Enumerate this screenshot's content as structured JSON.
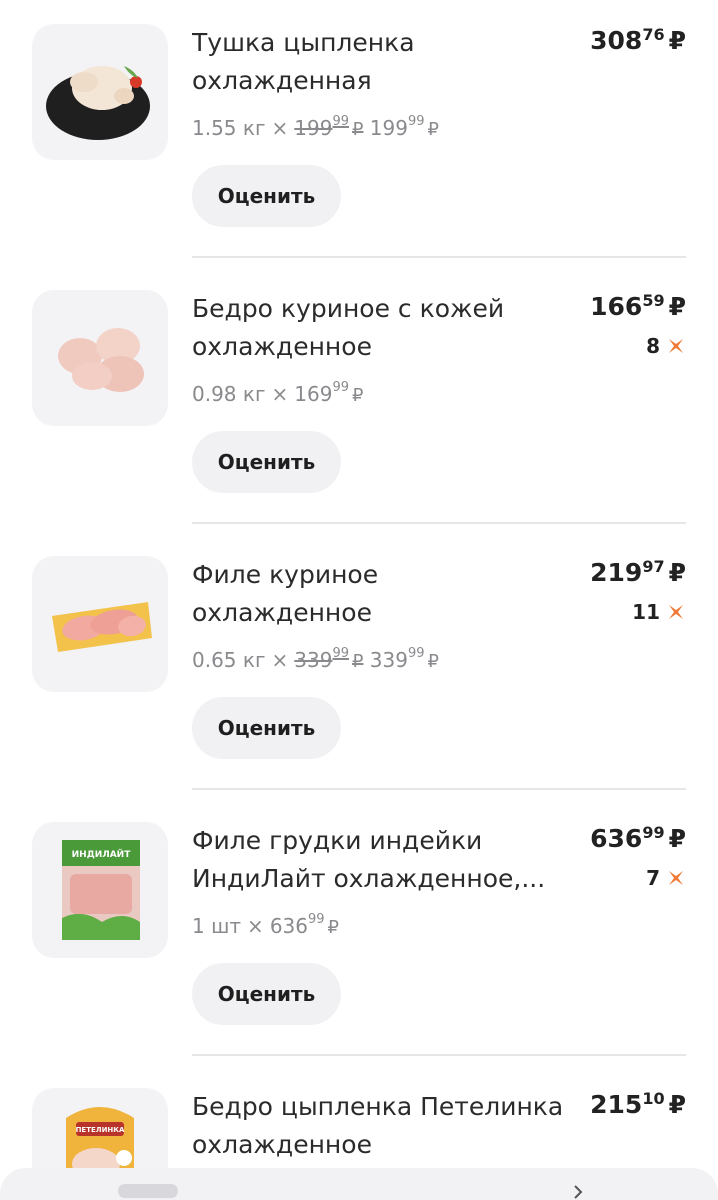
{
  "items": [
    {
      "title_lines": [
        "Тушка цыпленка",
        "охлажденная"
      ],
      "weight": "1.55 кг",
      "old_unit_price": {
        "int": "199",
        "dec": "99"
      },
      "unit_price": {
        "int": "199",
        "dec": "99"
      },
      "total": {
        "int": "308",
        "dec": "76"
      },
      "bonus": "",
      "rate_label": "Оценить",
      "image": "whole-chicken-image"
    },
    {
      "title_lines": [
        "Бедро куриное с кожей",
        "охлажденное"
      ],
      "weight": "0.98 кг",
      "old_unit_price": null,
      "unit_price": {
        "int": "169",
        "dec": "99"
      },
      "total": {
        "int": "166",
        "dec": "59"
      },
      "bonus": "8",
      "rate_label": "Оценить",
      "image": "chicken-thighs-image"
    },
    {
      "title_lines": [
        "Филе куриное",
        "охлажденное"
      ],
      "weight": "0.65 кг",
      "old_unit_price": {
        "int": "339",
        "dec": "99"
      },
      "unit_price": {
        "int": "339",
        "dec": "99"
      },
      "total": {
        "int": "219",
        "dec": "97"
      },
      "bonus": "11",
      "rate_label": "Оценить",
      "image": "chicken-fillet-image"
    },
    {
      "title_lines": [
        "Филе грудки индейки",
        "ИндиЛайт охлажденное,..."
      ],
      "weight": "1 шт",
      "old_unit_price": null,
      "unit_price": {
        "int": "636",
        "dec": "99"
      },
      "total": {
        "int": "636",
        "dec": "99"
      },
      "bonus": "7",
      "rate_label": "Оценить",
      "image": "turkey-fillet-package-image",
      "package_brand": "ИНДИЛАЙТ"
    },
    {
      "title_lines": [
        "Бедро цыпленка Петелинка",
        "охлажденное"
      ],
      "weight": "",
      "old_unit_price": null,
      "unit_price": null,
      "total": {
        "int": "215",
        "dec": "10"
      },
      "bonus": "",
      "rate_label": "",
      "image": "chicken-thigh-package-image",
      "package_brand": "ПЕТЕЛИНКА"
    }
  ],
  "currency": "₽",
  "times": "×",
  "colors": {
    "bonus_accent": "#f07a36",
    "button_bg": "#f1f1f4",
    "thumb_bg": "#f3f3f6",
    "divider": "#e6e6e9"
  }
}
